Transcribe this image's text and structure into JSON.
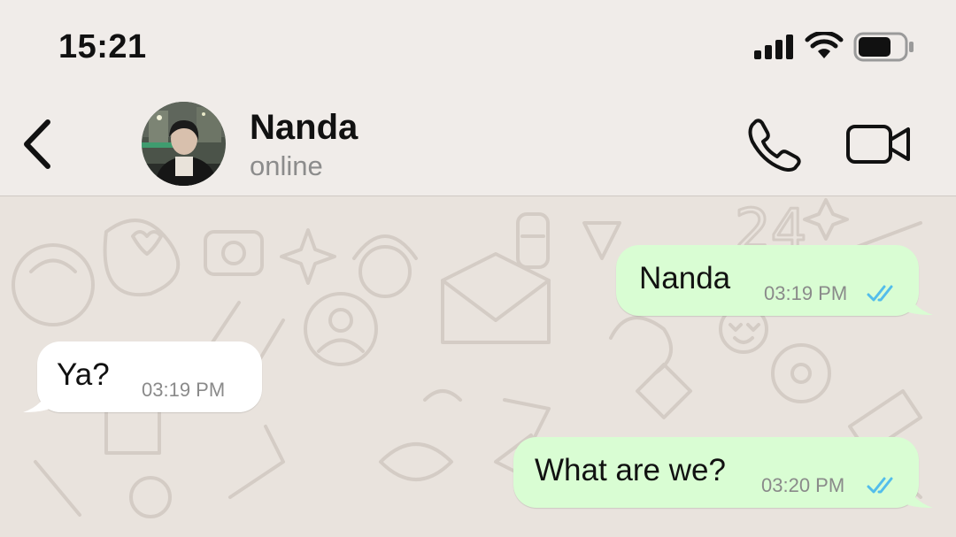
{
  "status_bar": {
    "time": "15:21",
    "signal_icon": "cellular-signal-icon",
    "wifi_icon": "wifi-icon",
    "battery_icon": "battery-icon"
  },
  "header": {
    "back_icon": "chevron-left-icon",
    "contact_name": "Nanda",
    "contact_status": "online",
    "call_icon": "phone-icon",
    "video_icon": "video-camera-icon"
  },
  "messages": [
    {
      "direction": "outgoing",
      "text": "Nanda",
      "time": "03:19 PM",
      "read_receipt": "double-check-icon"
    },
    {
      "direction": "incoming",
      "text": "Ya?",
      "time": "03:19 PM"
    },
    {
      "direction": "outgoing",
      "text": "What are we?",
      "time": "03:20 PM",
      "read_receipt": "double-check-icon"
    }
  ],
  "colors": {
    "outgoing_bubble": "#d9fdd3",
    "incoming_bubble": "#ffffff",
    "read_tick": "#53bdeb",
    "header_bg": "#f0ece9",
    "chat_bg": "#e9e3dd"
  }
}
